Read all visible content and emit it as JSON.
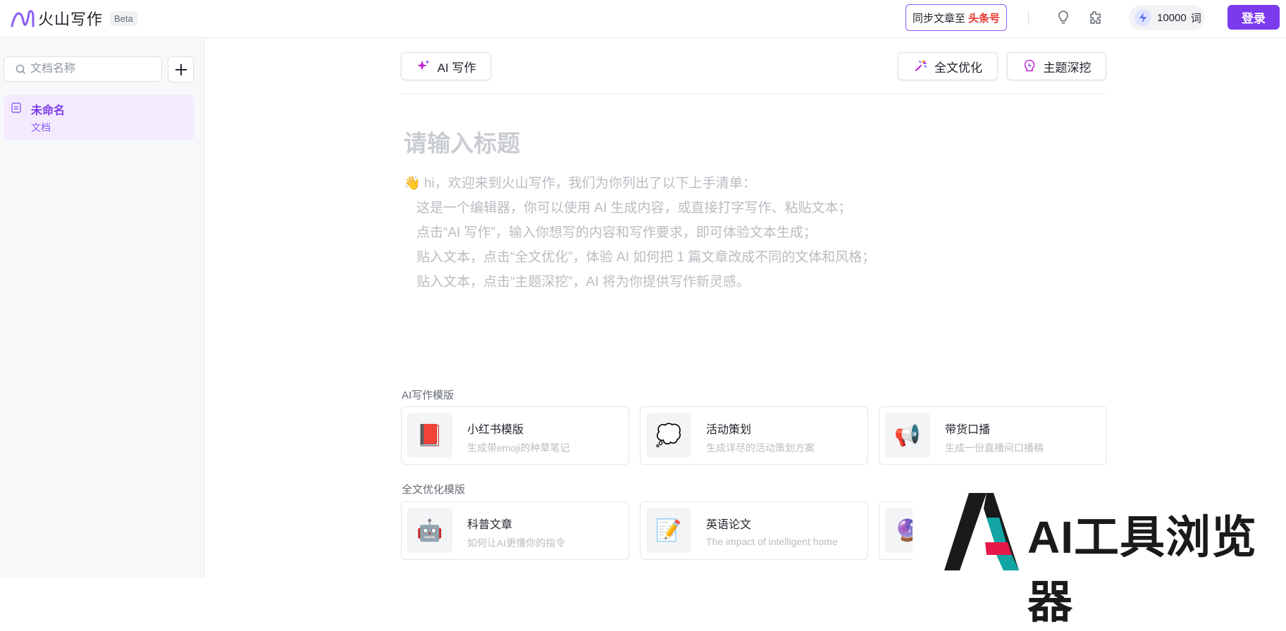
{
  "app": {
    "logo_text": "火山写作",
    "beta_label": "Beta"
  },
  "header": {
    "sync_label": "同步文章至",
    "sync_brand": "头条号",
    "credits_value": "10000",
    "credits_unit": "词",
    "login_label": "登录"
  },
  "sidebar": {
    "search_placeholder": "文档名称",
    "documents": [
      {
        "title": "未命名",
        "subtitle": "文档"
      }
    ]
  },
  "toolbar": {
    "ai_write": "AI 写作",
    "full_optimize": "全文优化",
    "topic_deep": "主题深挖"
  },
  "editor": {
    "title_placeholder": "请输入标题",
    "intro_lines": [
      "👋 hi，欢迎来到火山写作，我们为你列出了以下上手清单：",
      "这是一个编辑器，你可以使用 AI 生成内容，或直接打字写作、粘贴文本；",
      "点击“AI 写作”，输入你想写的内容和写作要求，即可体验文本生成；",
      "贴入文本，点击“全文优化”，体验 AI 如何把 1 篇文章改成不同的文体和风格；",
      "贴入文本，点击“主题深挖”，AI 将为你提供写作新灵感。"
    ]
  },
  "templates": {
    "ai_label": "AI写作模版",
    "ai_cards": [
      {
        "icon": "📕",
        "title": "小红书模版",
        "desc": "生成带emoji的种草笔记"
      },
      {
        "icon": "💭",
        "title": "活动策划",
        "desc": "生成详尽的活动策划方案"
      },
      {
        "icon": "📢",
        "title": "带货口播",
        "desc": "生成一份直播间口播稿"
      }
    ],
    "opt_label": "全文优化模版",
    "opt_cards": [
      {
        "icon": "🤖",
        "title": "科普文章",
        "desc": "如何让AI更懂你的指令"
      },
      {
        "icon": "📝",
        "title": "英语论文",
        "desc": "The impact of intelligent home"
      },
      {
        "icon": "🔮",
        "title": "",
        "desc": ""
      }
    ]
  },
  "watermark": {
    "text": "AI工具浏览器"
  },
  "colors": {
    "accent": "#7c3aed",
    "accent_light": "#f3ebfd",
    "brand_red": "#e8342f"
  }
}
